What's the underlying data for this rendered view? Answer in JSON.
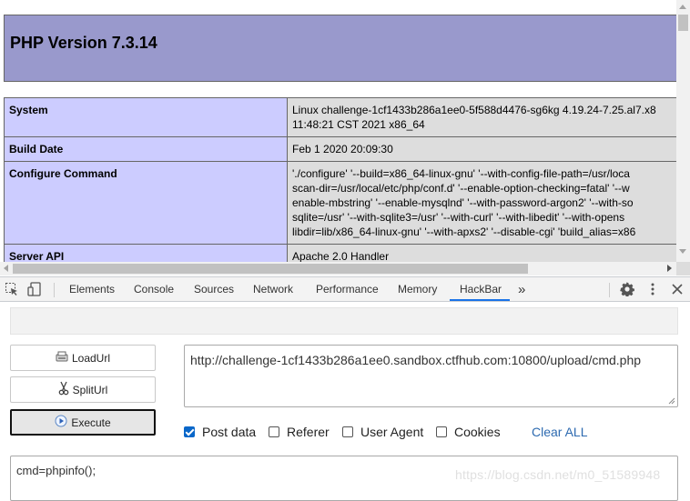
{
  "php_page": {
    "title": "PHP Version 7.3.14",
    "rows": [
      {
        "key": "System",
        "value_lines": [
          "Linux challenge-1cf1433b286a1ee0-5f588d4476-sg6kg 4.19.24-7.25.al7.x8",
          "11:48:21 CST 2021 x86_64"
        ]
      },
      {
        "key": "Build Date",
        "value_lines": [
          "Feb 1 2020 20:09:30"
        ]
      },
      {
        "key": "Configure Command",
        "value_lines": [
          "'./configure' '--build=x86_64-linux-gnu' '--with-config-file-path=/usr/loca",
          "scan-dir=/usr/local/etc/php/conf.d' '--enable-option-checking=fatal' '--w",
          "enable-mbstring' '--enable-mysqlnd' '--with-password-argon2' '--with-so",
          "sqlite=/usr' '--with-sqlite3=/usr' '--with-curl' '--with-libedit' '--with-opens",
          "libdir=lib/x86_64-linux-gnu' '--with-apxs2' '--disable-cgi' 'build_alias=x86"
        ]
      },
      {
        "key": "Server API",
        "value_lines": [
          "Apache 2.0 Handler"
        ]
      }
    ]
  },
  "devtools": {
    "tabs": [
      "Elements",
      "Console",
      "Sources",
      "Network",
      "Performance",
      "Memory",
      "HackBar"
    ],
    "active_tab": "HackBar",
    "more_tabs_icon": "chevron-double-right-icon",
    "accent_color": "#1a73e8"
  },
  "hackbar": {
    "load_url_label": "LoadUrl",
    "split_url_label": "SplitUrl",
    "execute_label": "Execute",
    "url_value": "http://challenge-1cf1433b286a1ee0.sandbox.ctfhub.com:10800/upload/cmd.php",
    "options": [
      {
        "label": "Post data",
        "checked": true
      },
      {
        "label": "Referer",
        "checked": false
      },
      {
        "label": "User Agent",
        "checked": false
      },
      {
        "label": "Cookies",
        "checked": false
      }
    ],
    "clear_all_label": "Clear ALL",
    "post_data_value": "cmd=phpinfo();",
    "watermark": "https://blog.csdn.net/m0_51589948"
  }
}
